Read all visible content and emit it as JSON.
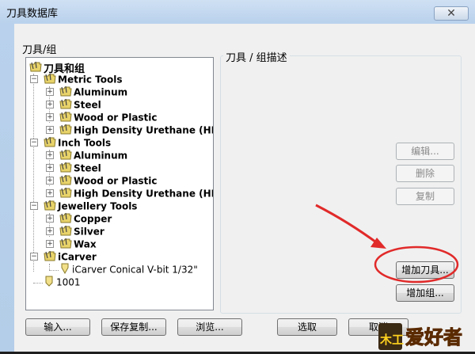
{
  "window": {
    "title": "刀具数据库",
    "close_glyph": "✕"
  },
  "tree_panel": {
    "label": "刀具/组",
    "root": "刀具和组",
    "groups": [
      {
        "label": "Metric Tools",
        "items": [
          "Aluminum",
          "Steel",
          "Wood or Plastic",
          "High Density Urethane (HDU)"
        ]
      },
      {
        "label": "Inch Tools",
        "items": [
          "Aluminum",
          "Steel",
          "Wood or Plastic",
          "High Density Urethane (HDU)"
        ]
      },
      {
        "label": "Jewellery Tools",
        "items": [
          "Copper",
          "Silver",
          "Wax"
        ]
      },
      {
        "label": "iCarver",
        "items": [
          "iCarver Conical V-bit 1/32\""
        ]
      }
    ],
    "extra_item": "1001"
  },
  "description_panel": {
    "label": "刀具 / 组描述"
  },
  "side_buttons": {
    "edit": "编辑...",
    "delete": "删除",
    "copy": "复制",
    "add_tool": "增加刀具...",
    "add_group": "增加组..."
  },
  "bottom_buttons": {
    "import": "输入...",
    "save_copy": "保存复制...",
    "browse": "浏览...",
    "select": "选取",
    "cancel": "取消"
  },
  "watermark": {
    "text": "爱好者",
    "badge": "木工"
  },
  "colors": {
    "annotation": "#e12a2a",
    "folder": "#e8d36a",
    "logo_text": "#ffd21f"
  }
}
